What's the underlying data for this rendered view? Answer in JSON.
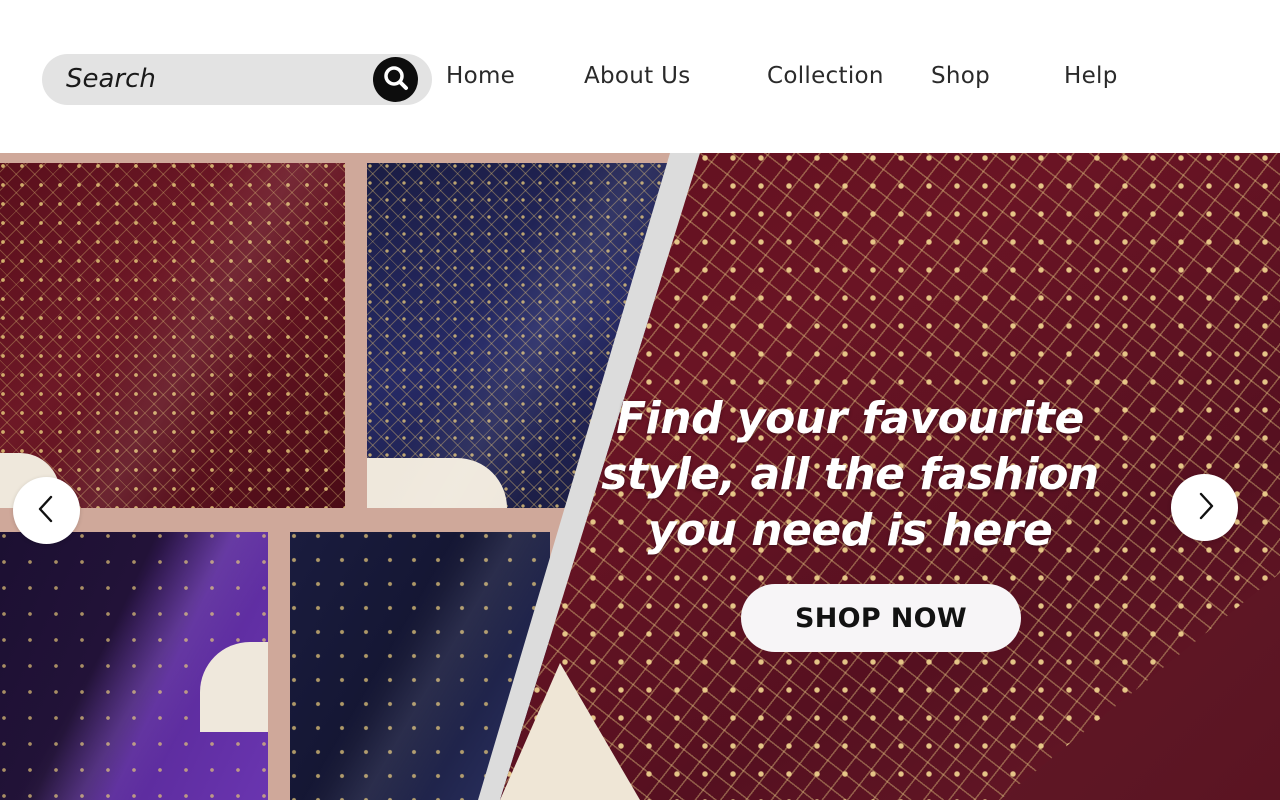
{
  "search": {
    "placeholder": "Search"
  },
  "nav": {
    "home": "Home",
    "about": "About Us",
    "collection": "Collection",
    "shop": "Shop",
    "help": "Help"
  },
  "hero": {
    "headline": "Find your favourite style, all the fashion you need is here",
    "cta": "SHOP NOW"
  },
  "colors": {
    "search_bg": "#e3e3e3",
    "search_button": "#0d0d0d",
    "cta_bg": "#f7f5f7",
    "maroon": "#5a0d1b",
    "navy": "#1b1d44",
    "purple": "#6a35b0",
    "backdrop": "#cfa89a"
  },
  "icons": {
    "search": "search-icon",
    "prev": "chevron-left-icon",
    "next": "chevron-right-icon"
  }
}
